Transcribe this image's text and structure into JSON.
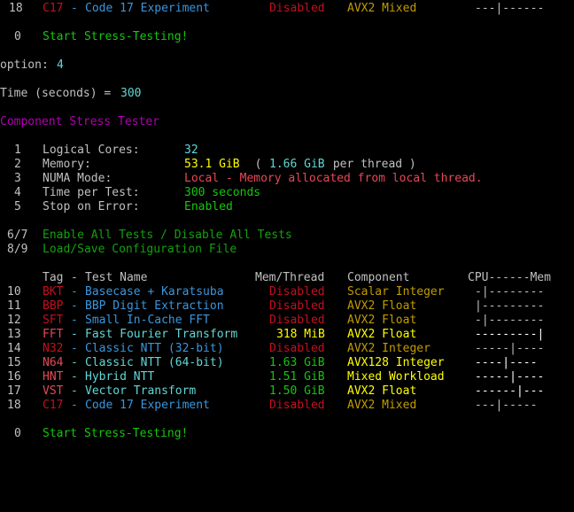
{
  "top_row": {
    "num": "18",
    "tag": "C17",
    "sep": "-",
    "name": "Code 17 Experiment",
    "mem": "Disabled",
    "comp": "AVX2 Mixed",
    "cpu": "---|------"
  },
  "start_top": {
    "num": "0",
    "label": "Start Stress-Testing!"
  },
  "option": {
    "label": "option: ",
    "value": "4"
  },
  "time": {
    "label": "Time (seconds) = ",
    "value": "300"
  },
  "title": "Component Stress Tester",
  "settings": [
    {
      "num": "1",
      "label": "Logical Cores:",
      "value": "32",
      "extra": ""
    },
    {
      "num": "2",
      "label": "Memory:",
      "value": "53.1 GiB",
      "extra_open": "  ( ",
      "extra_val": "1.66 GiB",
      "extra_close": " per thread )"
    },
    {
      "num": "3",
      "label": "NUMA Mode:",
      "value": "Local - Memory allocated from local thread."
    },
    {
      "num": "4",
      "label": "Time per Test:",
      "value": "300 seconds"
    },
    {
      "num": "5",
      "label": "Stop on Error:",
      "value": "Enabled"
    }
  ],
  "toggles": [
    {
      "num": "6/7",
      "label": "Enable All Tests / Disable All Tests"
    },
    {
      "num": "8/9",
      "label": "Load/Save Configuration File"
    }
  ],
  "table_header": {
    "tag": "Tag",
    "sep": "-",
    "name": "Test Name",
    "mem": "Mem/Thread",
    "comp": "Component",
    "cpu": "CPU------Mem"
  },
  "tests": [
    {
      "num": "10",
      "tag": "BKT",
      "name": "Basecase + Karatsuba",
      "mem": "Disabled",
      "comp": "Scalar Integer",
      "cpu": "-|--------",
      "enabled": false
    },
    {
      "num": "11",
      "tag": "BBP",
      "name": "BBP Digit Extraction",
      "mem": "Disabled",
      "comp": "AVX2 Float",
      "cpu": "|---------",
      "enabled": false
    },
    {
      "num": "12",
      "tag": "SFT",
      "name": "Small In-Cache FFT",
      "mem": "Disabled",
      "comp": "AVX2 Float",
      "cpu": "-|--------",
      "enabled": false
    },
    {
      "num": "13",
      "tag": "FFT",
      "name": "Fast Fourier Transform",
      "mem": "318 MiB",
      "comp": "AVX2 Float",
      "cpu": "---------|",
      "enabled": true
    },
    {
      "num": "14",
      "tag": "N32",
      "name": "Classic NTT (32-bit)",
      "mem": "Disabled",
      "comp": "AVX2 Integer",
      "cpu": "-----|----",
      "enabled": false
    },
    {
      "num": "15",
      "tag": "N64",
      "name": "Classic NTT (64-bit)",
      "mem": "1.63 GiB",
      "comp": "AVX128 Integer",
      "cpu": "----|----",
      "enabled": true
    },
    {
      "num": "16",
      "tag": "HNT",
      "name": "Hybrid NTT",
      "mem": "1.51 GiB",
      "comp": "Mixed Workload",
      "cpu": "-----|----",
      "enabled": true
    },
    {
      "num": "17",
      "tag": "VST",
      "name": "Vector Transform",
      "mem": "1.50 GiB",
      "comp": "AVX2 Float",
      "cpu": "------|---",
      "enabled": true
    },
    {
      "num": "18",
      "tag": "C17",
      "name": "Code 17 Experiment",
      "mem": "Disabled",
      "comp": "AVX2 Mixed",
      "cpu": "---|-----",
      "enabled": false
    }
  ],
  "start_bottom": {
    "num": "0",
    "label": "Start Stress-Testing!"
  }
}
